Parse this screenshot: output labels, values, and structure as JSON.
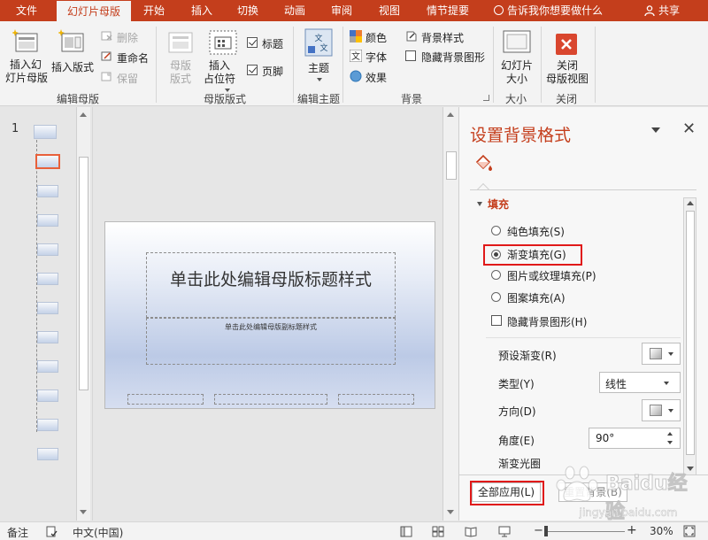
{
  "tabs": [
    "文件",
    "幻灯片母版",
    "开始",
    "插入",
    "切换",
    "动画",
    "审阅",
    "视图",
    "情节提要"
  ],
  "tell_me": "告诉我你想要做什么",
  "share": "共享",
  "ribbon": {
    "insert_master": "插入幻\n灯片母版",
    "insert_layout": "插入版式",
    "delete": "删除",
    "rename": "重命名",
    "preserve": "保留",
    "master_layout": "母版\n版式",
    "insert_placeholder": "插入\n占位符",
    "title_chk": "标题",
    "footer_chk": "页脚",
    "themes": "主题",
    "colors": "颜色",
    "fonts": "字体",
    "effects": "效果",
    "bg_styles": "背景样式",
    "hide_bg": "隐藏背景图形",
    "slide_size": "幻灯片\n大小",
    "close_view": "关闭\n母版视图",
    "groups": [
      "编辑母版",
      "母版版式",
      "编辑主题",
      "背景",
      "大小",
      "关闭"
    ]
  },
  "thumbs": {
    "number": "1"
  },
  "slide": {
    "title": "单击此处编辑母版标题样式",
    "subtitle": "单击此处编辑母版副标题样式",
    "footer_date": "",
    "footer_center": "",
    "footer_num": ""
  },
  "pane": {
    "title": "设置背景格式",
    "section": "填充",
    "solid": "纯色填充(S)",
    "gradient": "渐变填充(G)",
    "picture": "图片或纹理填充(P)",
    "pattern": "图案填充(A)",
    "hide_bg": "隐藏背景图形(H)",
    "preset": "预设渐变(R)",
    "type": "类型(Y)",
    "type_value": "线性",
    "direction": "方向(D)",
    "angle": "角度(E)",
    "angle_value": "90°",
    "stops": "渐变光圈",
    "apply_all": "全部应用(L)",
    "reset": "重置背景(B)"
  },
  "watermark": {
    "main": "Baidu经验",
    "sub": "jingyan.baidu.com"
  },
  "status": {
    "notes": "备注",
    "lang": "中文(中国)",
    "zoom": "30%"
  },
  "colors": {
    "accent": "#c43e1c",
    "highlight": "#e01919"
  }
}
